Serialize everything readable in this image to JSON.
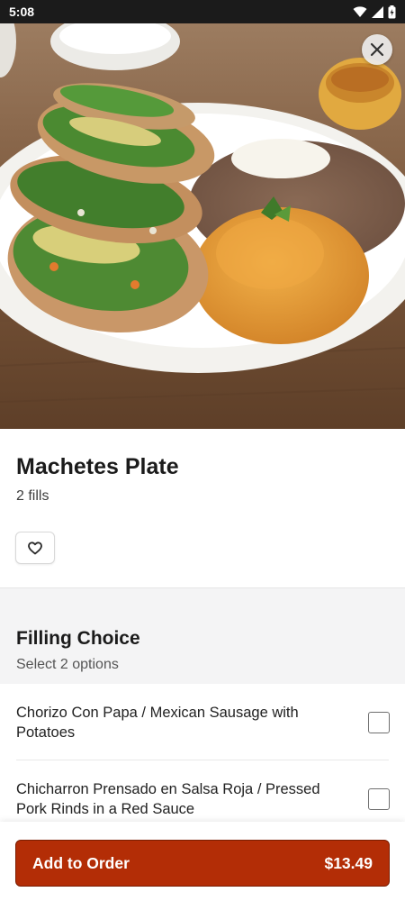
{
  "status_bar": {
    "time": "5:08"
  },
  "item": {
    "name": "Machetes Plate",
    "description": "2 fills"
  },
  "filling_section": {
    "title": "Filling Choice",
    "subtitle": "Select 2 options",
    "options": [
      {
        "label": "Chorizo Con Papa / Mexican Sausage with Potatoes",
        "checked": false
      },
      {
        "label": "Chicharron Prensado en Salsa Roja / Pressed Pork Rinds in a Red Sauce",
        "checked": false
      }
    ]
  },
  "footer": {
    "button_label": "Add to Order",
    "price": "$13.49"
  },
  "colors": {
    "accent": "#b32d06",
    "section_bg": "#f4f4f5"
  },
  "icons": [
    "wifi-icon",
    "signal-icon",
    "battery-icon",
    "close-icon",
    "heart-icon"
  ]
}
